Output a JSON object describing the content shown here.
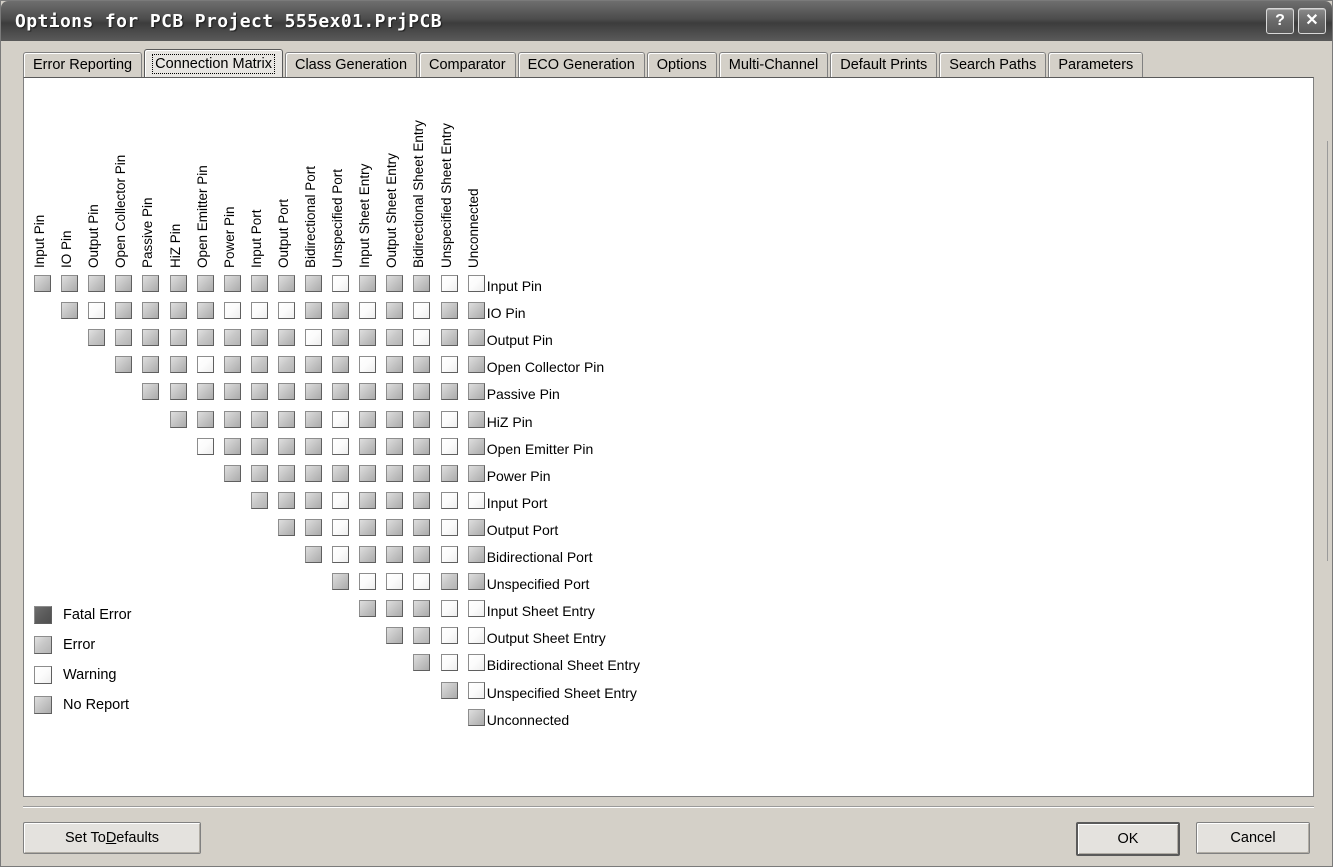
{
  "window": {
    "title": "Options for PCB Project 555ex01.PrjPCB",
    "help_button": "?",
    "close_button": "✕"
  },
  "tabs": [
    {
      "label": "Error Reporting",
      "active": false
    },
    {
      "label": "Connection Matrix",
      "active": true
    },
    {
      "label": "Class Generation",
      "active": false
    },
    {
      "label": "Comparator",
      "active": false
    },
    {
      "label": "ECO Generation",
      "active": false
    },
    {
      "label": "Options",
      "active": false
    },
    {
      "label": "Multi-Channel",
      "active": false
    },
    {
      "label": "Default Prints",
      "active": false
    },
    {
      "label": "Search Paths",
      "active": false
    },
    {
      "label": "Parameters",
      "active": false
    }
  ],
  "matrix": {
    "labels": [
      "Input Pin",
      "IO Pin",
      "Output Pin",
      "Open Collector Pin",
      "Passive Pin",
      "HiZ Pin",
      "Open Emitter Pin",
      "Power Pin",
      "Input Port",
      "Output Port",
      "Bidirectional Port",
      "Unspecified Port",
      "Input Sheet Entry",
      "Output Sheet Entry",
      "Bidirectional Sheet Entry",
      "Unspecified Sheet Entry",
      "Unconnected"
    ],
    "states": [
      "fatal",
      "error",
      "warning",
      "noreport"
    ],
    "rows": [
      [
        "noreport",
        "noreport",
        "noreport",
        "noreport",
        "noreport",
        "noreport",
        "noreport",
        "noreport",
        "noreport",
        "noreport",
        "noreport",
        "warning",
        "noreport",
        "noreport",
        "noreport",
        "warning",
        "warning"
      ],
      [
        null,
        "noreport",
        "warning",
        "noreport",
        "noreport",
        "noreport",
        "noreport",
        "warning",
        "warning",
        "warning",
        "noreport",
        "noreport",
        "warning",
        "noreport",
        "warning",
        "noreport",
        "noreport"
      ],
      [
        null,
        null,
        "error",
        "error",
        "noreport",
        "error",
        "error",
        "error",
        "noreport",
        "noreport",
        "warning",
        "noreport",
        "noreport",
        "error",
        "warning",
        "noreport",
        "noreport"
      ],
      [
        null,
        null,
        null,
        "noreport",
        "noreport",
        "noreport",
        "warning",
        "noreport",
        "error",
        "error",
        "noreport",
        "noreport",
        "warning",
        "noreport",
        "noreport",
        "warning",
        "noreport"
      ],
      [
        null,
        null,
        null,
        null,
        "noreport",
        "noreport",
        "noreport",
        "noreport",
        "noreport",
        "noreport",
        "noreport",
        "noreport",
        "noreport",
        "noreport",
        "noreport",
        "noreport",
        "noreport"
      ],
      [
        null,
        null,
        null,
        null,
        null,
        "noreport",
        "noreport",
        "noreport",
        "error",
        "noreport",
        "noreport",
        "warning",
        "noreport",
        "noreport",
        "noreport",
        "warning",
        "noreport"
      ],
      [
        null,
        null,
        null,
        null,
        null,
        null,
        "warning",
        "noreport",
        "noreport",
        "noreport",
        "noreport",
        "warning",
        "noreport",
        "noreport",
        "noreport",
        "warning",
        "noreport"
      ],
      [
        null,
        null,
        null,
        null,
        null,
        null,
        null,
        "noreport",
        "noreport",
        "noreport",
        "noreport",
        "noreport",
        "noreport",
        "noreport",
        "noreport",
        "noreport",
        "noreport"
      ],
      [
        null,
        null,
        null,
        null,
        null,
        null,
        null,
        null,
        "error",
        "noreport",
        "noreport",
        "warning",
        "noreport",
        "noreport",
        "noreport",
        "warning",
        "warning"
      ],
      [
        null,
        null,
        null,
        null,
        null,
        null,
        null,
        null,
        null,
        "noreport",
        "noreport",
        "warning",
        "noreport",
        "noreport",
        "noreport",
        "warning",
        "noreport"
      ],
      [
        null,
        null,
        null,
        null,
        null,
        null,
        null,
        null,
        null,
        null,
        "noreport",
        "warning",
        "noreport",
        "noreport",
        "noreport",
        "warning",
        "noreport"
      ],
      [
        null,
        null,
        null,
        null,
        null,
        null,
        null,
        null,
        null,
        null,
        null,
        "noreport",
        "warning",
        "warning",
        "warning",
        "error",
        "noreport"
      ],
      [
        null,
        null,
        null,
        null,
        null,
        null,
        null,
        null,
        null,
        null,
        null,
        null,
        "noreport",
        "noreport",
        "noreport",
        "warning",
        "warning"
      ],
      [
        null,
        null,
        null,
        null,
        null,
        null,
        null,
        null,
        null,
        null,
        null,
        null,
        null,
        "noreport",
        "error",
        "warning",
        "warning"
      ],
      [
        null,
        null,
        null,
        null,
        null,
        null,
        null,
        null,
        null,
        null,
        null,
        null,
        null,
        null,
        "noreport",
        "warning",
        "warning"
      ],
      [
        null,
        null,
        null,
        null,
        null,
        null,
        null,
        null,
        null,
        null,
        null,
        null,
        null,
        null,
        null,
        "noreport",
        "warning"
      ],
      [
        null,
        null,
        null,
        null,
        null,
        null,
        null,
        null,
        null,
        null,
        null,
        null,
        null,
        null,
        null,
        null,
        "noreport"
      ]
    ]
  },
  "legend": [
    {
      "state": "fatal",
      "label": "Fatal Error"
    },
    {
      "state": "error",
      "label": "Error"
    },
    {
      "state": "warning",
      "label": "Warning"
    },
    {
      "state": "noreport",
      "label": "No Report"
    }
  ],
  "buttons": {
    "set_to_defaults": "Set To Defaults",
    "set_to_defaults_accel": "D",
    "ok": "OK",
    "cancel": "Cancel"
  },
  "colors": {
    "fatal": "#5a5a5a",
    "error": "#c8c8c8",
    "warning": "#fbfbfb",
    "noreport": "#c4c4c4",
    "window_face": "#d4d0c8",
    "page_face": "#ffffff",
    "titlebar": "#4c4c4c"
  }
}
